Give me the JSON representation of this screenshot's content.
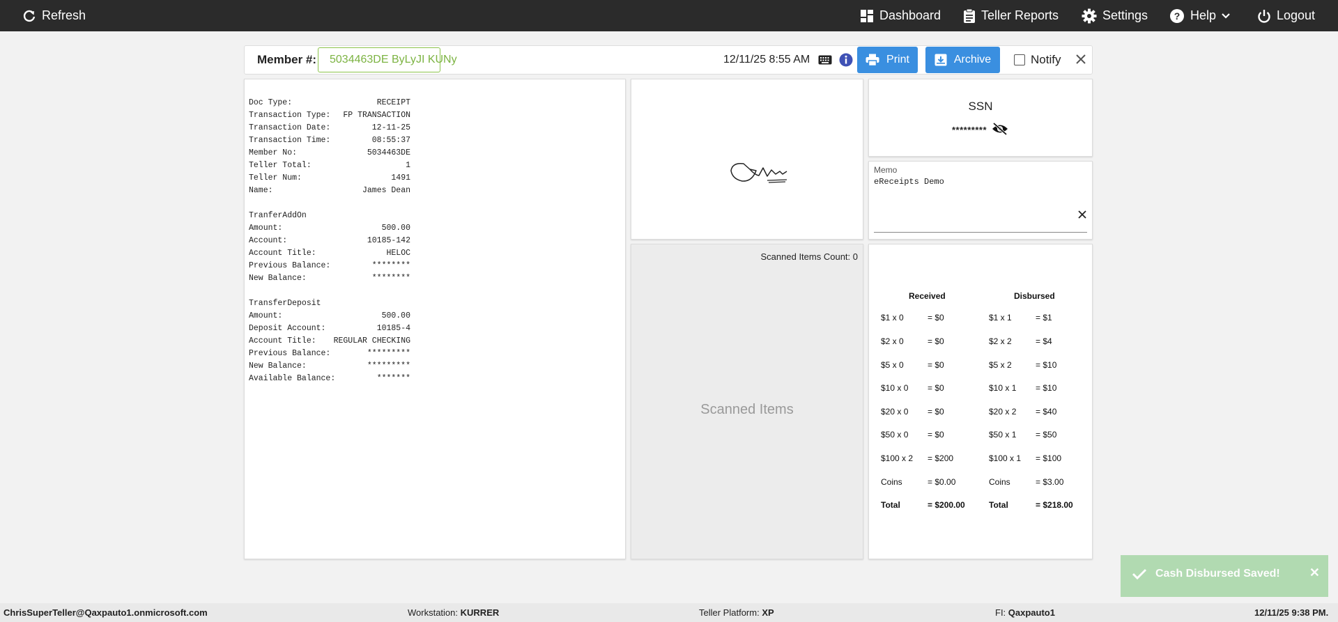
{
  "topbar": {
    "refresh_label": "Refresh",
    "dashboard_label": "Dashboard",
    "teller_reports_label": "Teller Reports",
    "settings_label": "Settings",
    "help_label": "Help",
    "logout_label": "Logout"
  },
  "header": {
    "member_label": "Member #:",
    "member_value": "5034463DE ByLyJI KUNy",
    "datetime": "12/11/25 8:55 AM",
    "print_label": "Print",
    "archive_label": "Archive",
    "notify_label": "Notify"
  },
  "receipt": {
    "block1": [
      {
        "label": "Doc Type:",
        "value": "RECEIPT"
      },
      {
        "label": "Transaction Type:",
        "value": "FP TRANSACTION"
      },
      {
        "label": "Transaction Date:",
        "value": "12-11-25"
      },
      {
        "label": "Transaction Time:",
        "value": "08:55:37"
      },
      {
        "label": "Member No:",
        "value": "5034463DE"
      },
      {
        "label": "Teller Total:",
        "value": "1"
      },
      {
        "label": "Teller Num:",
        "value": "1491"
      },
      {
        "label": "Name:",
        "value": "James Dean"
      }
    ],
    "block2_title": "TranferAddOn",
    "block2": [
      {
        "label": "Amount:",
        "value": "500.00"
      },
      {
        "label": "Account:",
        "value": "10185-142"
      },
      {
        "label": "Account Title:",
        "value": "HELOC"
      },
      {
        "label": "Previous Balance:",
        "value": "********"
      },
      {
        "label": "New Balance:",
        "value": "********"
      }
    ],
    "block3_title": "TransferDeposit",
    "block3": [
      {
        "label": "Amount:",
        "value": "500.00"
      },
      {
        "label": "Deposit Account:",
        "value": "10185-4"
      },
      {
        "label": "Account Title:",
        "value": "REGULAR CHECKING"
      },
      {
        "label": "Previous Balance:",
        "value": "*********"
      },
      {
        "label": "New Balance:",
        "value": "*********"
      },
      {
        "label": "Available Balance:",
        "value": "*******"
      }
    ]
  },
  "ssn": {
    "title": "SSN",
    "masked": "*********"
  },
  "memo": {
    "label": "Memo",
    "text": "eReceipts Demo"
  },
  "scanned": {
    "count_label": "Scanned Items Count: 0",
    "placeholder": "Scanned Items"
  },
  "cash": {
    "received_header": "Received",
    "disbursed_header": "Disbursed",
    "received": [
      {
        "denom": "$1 x 0",
        "amount": "= $0"
      },
      {
        "denom": "$2 x 0",
        "amount": "= $0"
      },
      {
        "denom": "$5 x 0",
        "amount": "= $0"
      },
      {
        "denom": "$10 x 0",
        "amount": "= $0"
      },
      {
        "denom": "$20 x 0",
        "amount": "= $0"
      },
      {
        "denom": "$50 x 0",
        "amount": "= $0"
      },
      {
        "denom": "$100 x 2",
        "amount": "= $200"
      },
      {
        "denom": "Coins",
        "amount": "= $0.00"
      },
      {
        "denom": "Total",
        "amount": "= $200.00"
      }
    ],
    "disbursed": [
      {
        "denom": "$1 x 1",
        "amount": "= $1"
      },
      {
        "denom": "$2 x 2",
        "amount": "= $4"
      },
      {
        "denom": "$5 x 2",
        "amount": "= $10"
      },
      {
        "denom": "$10 x 1",
        "amount": "= $10"
      },
      {
        "denom": "$20 x 2",
        "amount": "= $40"
      },
      {
        "denom": "$50 x 1",
        "amount": "= $50"
      },
      {
        "denom": "$100 x 1",
        "amount": "= $100"
      },
      {
        "denom": "Coins",
        "amount": "= $3.00"
      },
      {
        "denom": "Total",
        "amount": "= $218.00"
      }
    ]
  },
  "toast": {
    "message": "Cash Disbursed Saved!"
  },
  "footer": {
    "user": "ChrisSuperTeller@Qaxpauto1.onmicrosoft.com",
    "workstation_label": "Workstation:",
    "workstation_value": "KURRER",
    "platform_label": "Teller Platform:",
    "platform_value": "XP",
    "fi_label": "FI:",
    "fi_value": "Qaxpauto1",
    "datetime": "12/11/25 9:38 PM."
  },
  "colors": {
    "topbar_bg": "#2b2b2b",
    "button_blue": "#3a8fe0",
    "member_green": "#7cb342",
    "toast_green": "#a6d6a6"
  }
}
